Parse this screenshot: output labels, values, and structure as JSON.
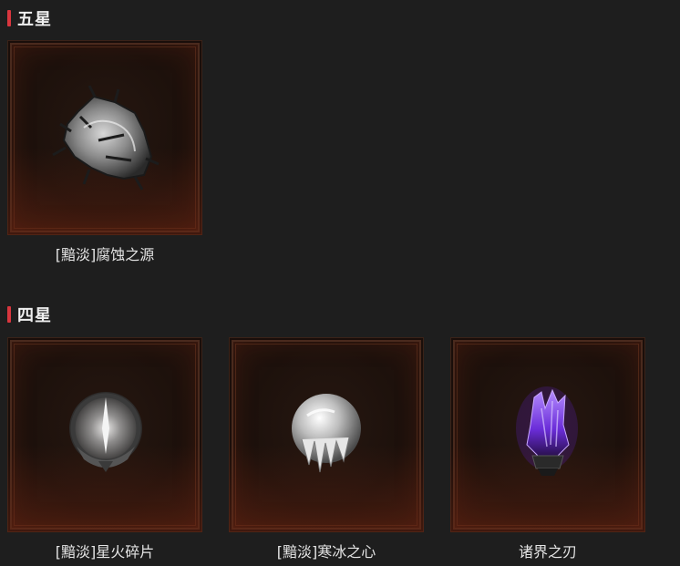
{
  "sections": [
    {
      "title": "五星",
      "items": [
        {
          "name": "[黯淡]腐蚀之源",
          "icon": "corrupted-source-icon"
        }
      ]
    },
    {
      "title": "四星",
      "items": [
        {
          "name": "[黯淡]星火碎片",
          "icon": "starfire-shard-icon"
        },
        {
          "name": "[黯淡]寒冰之心",
          "icon": "frost-heart-icon"
        },
        {
          "name": "诸界之刃",
          "icon": "realm-blade-icon"
        }
      ]
    }
  ],
  "colors": {
    "accent_bar": "#d9363e",
    "background": "#1e1e1e",
    "frame_border": "#4a2a1d",
    "blade_purple": "#7a3cff"
  }
}
